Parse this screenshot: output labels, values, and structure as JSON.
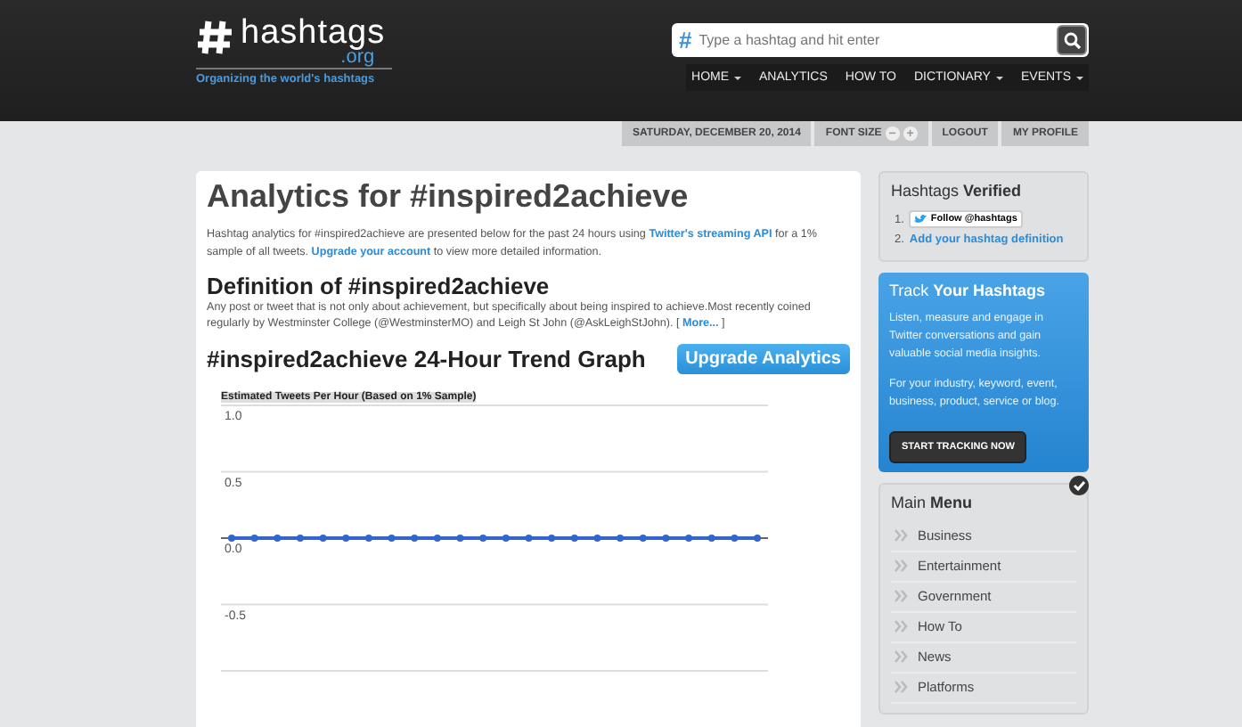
{
  "header": {
    "logo": {
      "name": "hashtags",
      "tld": ".org",
      "tagline": "Organizing the world's hashtags"
    },
    "search": {
      "icon": "#",
      "placeholder": "Type a hashtag and hit enter"
    },
    "nav": [
      {
        "label": "HOME",
        "dropdown": true
      },
      {
        "label": "ANALYTICS",
        "dropdown": false
      },
      {
        "label": "HOW TO",
        "dropdown": false
      },
      {
        "label": "DICTIONARY",
        "dropdown": true
      },
      {
        "label": "EVENTS",
        "dropdown": true
      }
    ]
  },
  "utility_bar": {
    "date": "SATURDAY, DECEMBER 20, 2014",
    "font_size": "FONT SIZE",
    "font_controls": [
      "−",
      "+"
    ],
    "links": [
      "LOGOUT",
      "MY PROFILE"
    ]
  },
  "main": {
    "title": "Analytics for #inspired2achieve",
    "intro": [
      {
        "text": "Hashtag analytics for #inspired2achieve are presented below for the past 24 hours using ",
        "link": false
      },
      {
        "text": "Twitter's streaming API",
        "link": true
      },
      {
        "text": " for a 1% sample of all tweets. ",
        "link": false
      },
      {
        "text": "Upgrade your account",
        "link": true
      },
      {
        "text": " to view more detailed information.",
        "link": false
      }
    ],
    "definition_heading": "Definition of #inspired2achieve",
    "definition": [
      {
        "text": "Any post or tweet that is not only about achievement, but specifically about being inspired to achieve.Most recently coined regularly by Westminster College (@WestminsterMO) and Leigh St John (@AskLeighStJohn).  [ ",
        "link": false
      },
      {
        "text": "More...",
        "link": true
      },
      {
        "text": " ]",
        "link": false
      }
    ],
    "graph_heading": "#inspired2achieve 24-Hour Trend Graph",
    "upgrade_button": "Upgrade Analytics",
    "chart_data": {
      "type": "line",
      "title": "Estimated Tweets Per Hour (Based on 1% Sample)",
      "ylim": [
        -1,
        1
      ],
      "yticks": [
        {
          "value": 1,
          "label": "1.0"
        },
        {
          "value": 0.5,
          "label": "0.5"
        },
        {
          "value": 0,
          "label": "0.0"
        },
        {
          "value": -0.5,
          "label": "-0.5"
        }
      ],
      "series": [
        {
          "marker": true,
          "color": "#3366cc",
          "values": [
            0,
            0,
            0,
            0,
            0,
            0,
            0,
            0,
            0,
            0,
            0,
            0,
            0,
            0,
            0,
            0,
            0,
            0,
            0,
            0,
            0,
            0,
            0,
            0
          ]
        }
      ]
    }
  },
  "sidebar": {
    "verified": {
      "title": "Hashtags **Verified**",
      "items": [
        {
          "kind": "follow",
          "number": "1.",
          "text": "Follow @hashtags"
        },
        {
          "kind": "link",
          "number": "2.",
          "text": "Add your hashtag definition"
        }
      ]
    },
    "track": {
      "title": "Track **Your Hashtags**",
      "paragraphs": [
        "Listen, measure and engage in Twitter conversations and gain valuable social media insights.",
        "For your industry, keyword, event, business, product, service or blog."
      ],
      "button": "START TRACKING NOW"
    },
    "menu": {
      "title": "Main **Menu**",
      "items": [
        "Business",
        "Entertainment",
        "Government",
        "How To",
        "News",
        "Platforms"
      ]
    }
  }
}
